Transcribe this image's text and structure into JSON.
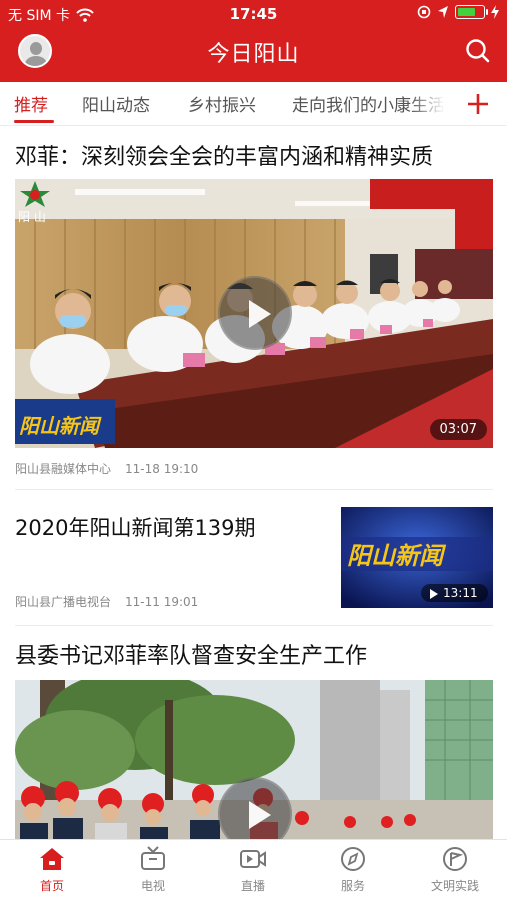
{
  "status_bar": {
    "carrier": "无 SIM 卡",
    "time": "17:45",
    "battery_level": 0.75
  },
  "header": {
    "title": "今日阳山"
  },
  "tabs": [
    {
      "label": "推荐",
      "active": true
    },
    {
      "label": "阳山动态"
    },
    {
      "label": "乡村振兴"
    },
    {
      "label": "走向我们的小康生活"
    }
  ],
  "articles": [
    {
      "title": "邓菲：深刻领会全会的丰富内涵和精神实质",
      "source": "阳山县融媒体中心",
      "date": "11-18 19:10",
      "duration": "03:07",
      "image_overlay": {
        "logo_text": "阳 山",
        "caption_banner": "阳山新闻"
      }
    },
    {
      "title": "2020年阳山新闻第139期",
      "source": "阳山县广播电视台",
      "date": "11-11 19:01",
      "duration": "13:11",
      "thumbnail_text": "阳山新闻"
    },
    {
      "title": "县委书记邓菲率队督查安全生产工作"
    }
  ],
  "bottom_nav": [
    {
      "label": "首页",
      "icon": "home-icon",
      "active": true
    },
    {
      "label": "电视",
      "icon": "tv-icon"
    },
    {
      "label": "直播",
      "icon": "live-icon"
    },
    {
      "label": "服务",
      "icon": "compass-icon"
    },
    {
      "label": "文明实践",
      "icon": "flag-badge-icon"
    }
  ],
  "colors": {
    "brand_red": "#d71f1f",
    "inactive_gray": "#888888"
  }
}
